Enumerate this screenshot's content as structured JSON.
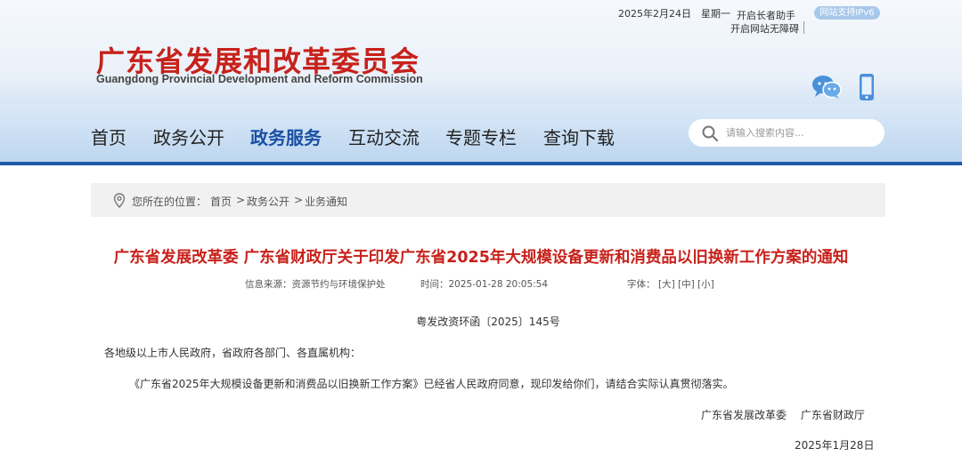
{
  "topbar": {
    "date": "2025年2月24日",
    "weekday": "星期一",
    "elder_mode": "开启长者助手",
    "accessibility": "开启网站无障碍",
    "ipv6_badge": "网站支持IPv6"
  },
  "logo": {
    "name_cn": "广东省发展和改革委员会",
    "name_en": "Guangdong Provincial Development and Reform Commission"
  },
  "header_icons": [
    "wechat-icon",
    "mobile-phone-icon"
  ],
  "nav": {
    "items": [
      {
        "label": "首页"
      },
      {
        "label": "政务公开"
      },
      {
        "label": "政务服务",
        "active": true
      },
      {
        "label": "互动交流"
      },
      {
        "label": "专题专栏"
      },
      {
        "label": "查询下载"
      }
    ]
  },
  "search": {
    "placeholder": "请输入搜索内容..."
  },
  "breadcrumb": {
    "prefix": "您所在的位置：",
    "items": [
      "首页",
      "政务公开",
      "业务通知"
    ],
    "separator": ">"
  },
  "article": {
    "title": "广东省发展改革委 广东省财政厅关于印发广东省2025年大规模设备更新和消费品以旧换新工作方案的通知",
    "source_label": "信息来源：",
    "source": "资源节约与环境保护处",
    "time_label": "时间：",
    "time": "2025-01-28 20:05:54",
    "font_label": "字体：",
    "font_sizes": [
      "[大]",
      "[中]",
      "[小]"
    ],
    "doc_number": "粤发改资环函〔2025〕145号",
    "salutation": "各地级以上市人民政府，省政府各部门、各直属机构：",
    "body": "《广东省2025年大规模设备更新和消费品以旧换新工作方案》已经省人民政府同意，现印发给你们，请结合实际认真贯彻落实。",
    "signatories": "广东省发展改革委　 广东省财政厅",
    "sign_date": "2025年1月28日"
  },
  "colors": {
    "brand_red": "#c8211b",
    "nav_active": "#1b4fa3",
    "nav_line": "#1e5aa8"
  }
}
